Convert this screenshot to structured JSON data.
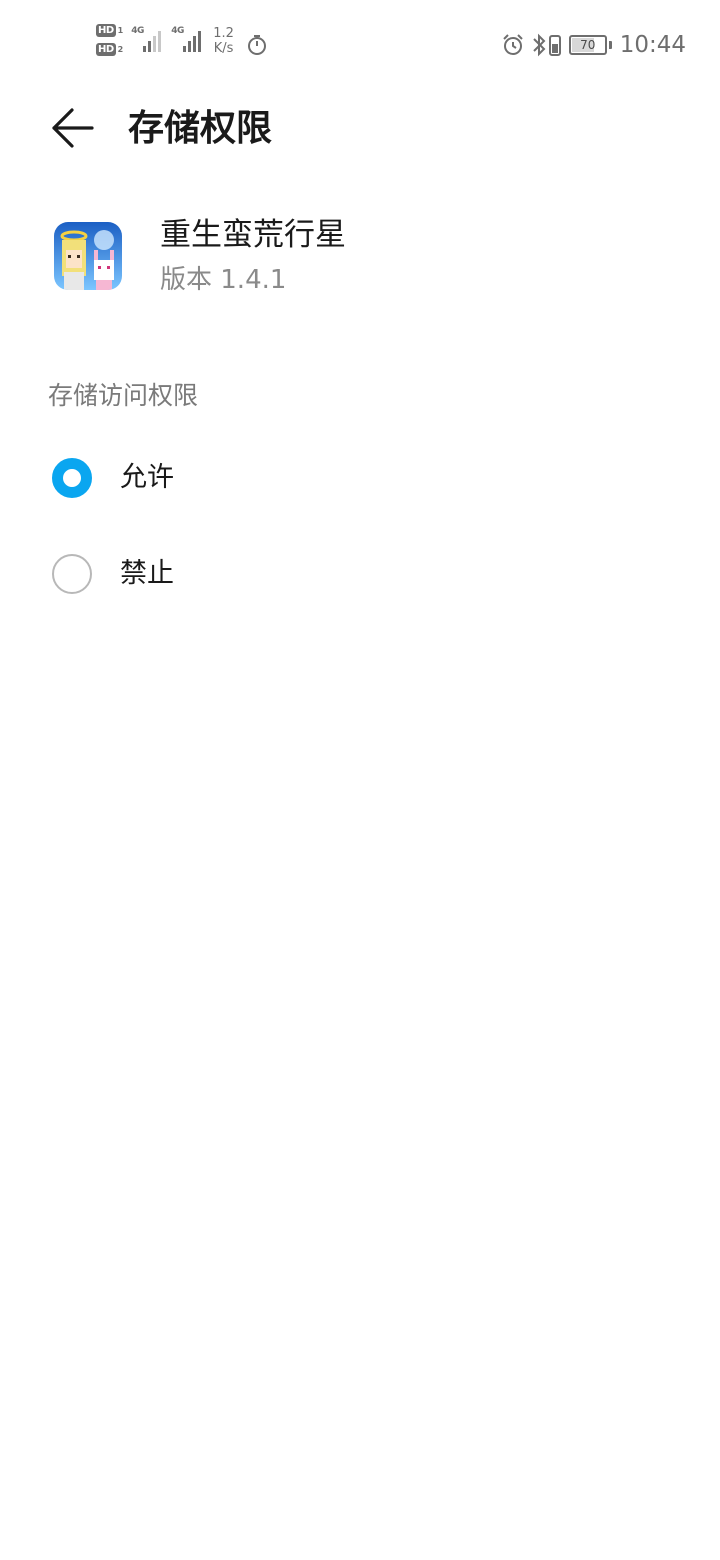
{
  "status_bar": {
    "sim1_label": "HD",
    "sim1_index": "1",
    "sim2_label": "HD",
    "sim2_index": "2",
    "network1": "4G",
    "network2": "4G",
    "net_speed_value": "1.2",
    "net_speed_unit": "K/s",
    "battery_level": "70",
    "battery_percent": 70,
    "time": "10:44",
    "icons": [
      "stopwatch-icon",
      "alarm-icon",
      "bluetooth-icon",
      "vibrate-icon",
      "battery-icon"
    ]
  },
  "header": {
    "back_icon": "back-arrow-icon",
    "title": "存储权限"
  },
  "app": {
    "name": "重生蛮荒行星",
    "version": "版本 1.4.1"
  },
  "permission": {
    "section_label": "存储访问权限",
    "options": [
      {
        "label": "允许",
        "selected": true
      },
      {
        "label": "禁止",
        "selected": false
      }
    ]
  },
  "colors": {
    "accent": "#0aa6f0",
    "status_gray": "#6e6e6e"
  }
}
